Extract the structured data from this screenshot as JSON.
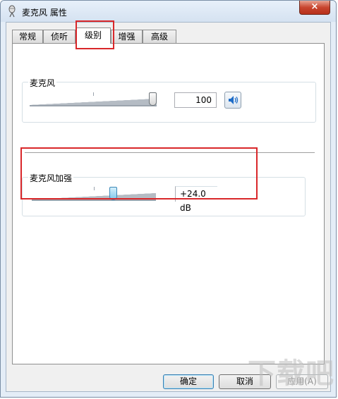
{
  "window": {
    "title": "麦克风 属性",
    "close_label": "×",
    "icon": "microphone-icon"
  },
  "tabs": [
    {
      "label": "常规"
    },
    {
      "label": "侦听"
    },
    {
      "label": "级别",
      "active": true
    },
    {
      "label": "增强"
    },
    {
      "label": "高级"
    }
  ],
  "microphone": {
    "label": "麦克风",
    "level": 100,
    "value_text": "100",
    "mute_icon": "speaker-icon"
  },
  "boost": {
    "label": "麦克风加强",
    "level_db": 24.0,
    "value_text": "+24.0 dB"
  },
  "buttons": {
    "ok": "确定",
    "cancel": "取消",
    "apply": "应用(A)"
  },
  "watermark": "下载吧",
  "colors": {
    "highlight": "#d9272a",
    "window_frame": "#e4edf7"
  }
}
